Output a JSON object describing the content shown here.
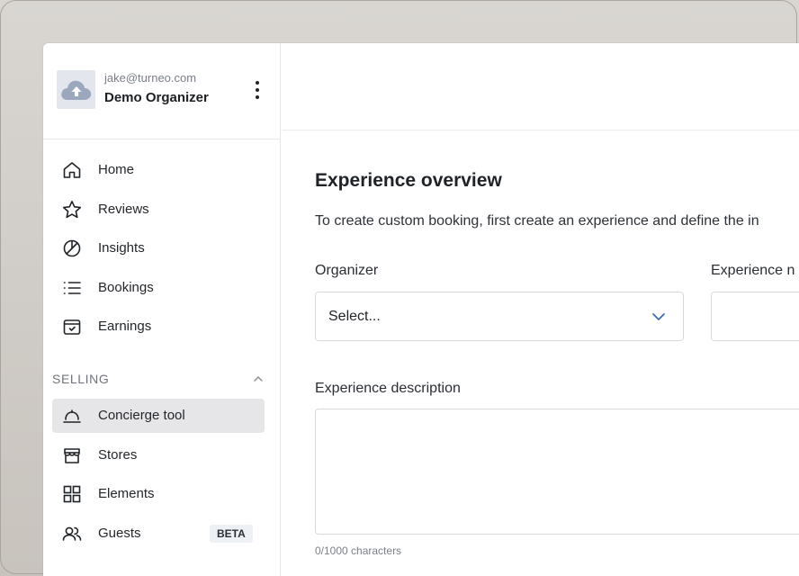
{
  "org": {
    "email": "jake@turneo.com",
    "name": "Demo Organizer",
    "avatar_icon": "cloud-upload-icon",
    "menu_icon": "kebab-menu-icon"
  },
  "nav": {
    "items": [
      {
        "label": "Home",
        "icon": "home-icon"
      },
      {
        "label": "Reviews",
        "icon": "star-icon"
      },
      {
        "label": "Insights",
        "icon": "pie-chart-icon"
      },
      {
        "label": "Bookings",
        "icon": "list-icon"
      },
      {
        "label": "Earnings",
        "icon": "wallet-icon"
      }
    ],
    "selling_section": {
      "title": "SELLING",
      "collapse_icon": "chevron-up-icon",
      "items": [
        {
          "label": "Concierge tool",
          "icon": "bell-service-icon",
          "active": true
        },
        {
          "label": "Stores",
          "icon": "store-icon"
        },
        {
          "label": "Elements",
          "icon": "grid-icon"
        },
        {
          "label": "Guests",
          "icon": "users-icon",
          "badge": "BETA"
        }
      ]
    }
  },
  "main": {
    "title": "Experience overview",
    "description": "To create custom booking, first create an experience and define the in",
    "organizer_field": {
      "label": "Organizer",
      "value": "Select...",
      "icon": "chevron-down-icon"
    },
    "experience_name_field": {
      "label": "Experience n"
    },
    "description_field": {
      "label": "Experience description",
      "counter": "0/1000 characters"
    }
  },
  "colors": {
    "active_nav_bg": "#e6e6e8",
    "accent_chevron": "#3b6fb6",
    "badge_bg": "#edf0f5",
    "avatar_bg": "#e3e6ec",
    "avatar_icon": "#9aa7bd"
  }
}
